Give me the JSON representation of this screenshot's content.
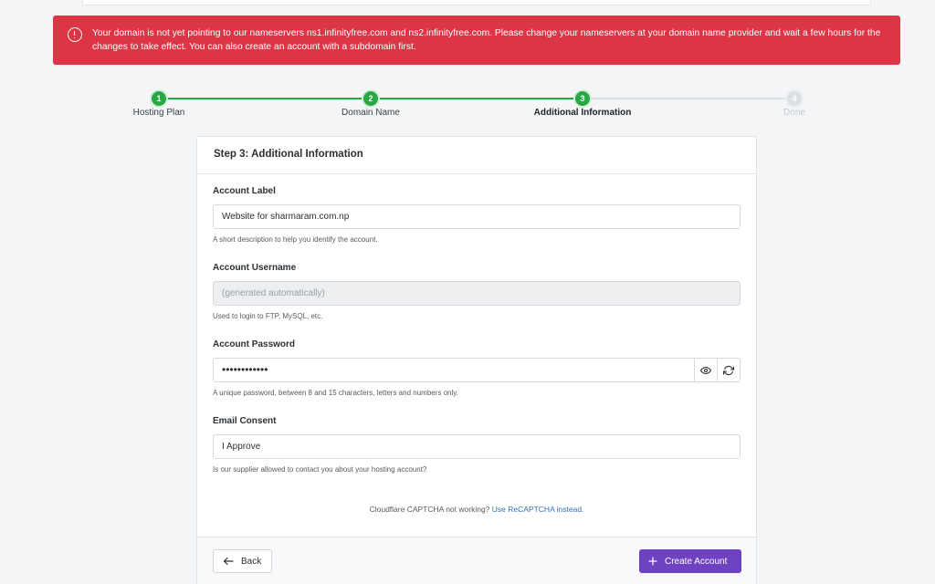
{
  "alert": {
    "text": "Your domain is not yet pointing to our nameservers ns1.infinityfree.com and ns2.infinityfree.com. Please change your nameservers at your domain name provider and wait a few hours for the changes to take effect. You can also create an account with a subdomain first.",
    "color": "#dc3545"
  },
  "stepper": {
    "steps": [
      {
        "number": "1",
        "label": "Hosting Plan",
        "state": "done"
      },
      {
        "number": "2",
        "label": "Domain Name",
        "state": "done"
      },
      {
        "number": "3",
        "label": "Additional Information",
        "state": "active"
      },
      {
        "number": "4",
        "label": "Done",
        "state": "todo"
      }
    ],
    "done_color": "#28a745"
  },
  "card": {
    "title": "Step 3: Additional Information",
    "fields": {
      "account_label": {
        "label": "Account Label",
        "value": "Website for sharmaram.com.np",
        "help": "A short description to help you identify the account."
      },
      "account_username": {
        "label": "Account Username",
        "placeholder": "(generated automatically)",
        "help": "Used to login to FTP, MySQL, etc."
      },
      "account_password": {
        "label": "Account Password",
        "value": "••••••••••••",
        "help": "A unique password, between 8 and 15 characters, letters and numbers only.",
        "show_icon": "eye-icon",
        "generate_icon": "refresh-icon"
      },
      "email_consent": {
        "label": "Email Consent",
        "value": "I Approve",
        "help": "Is our supplier allowed to contact you about your hosting account?"
      }
    },
    "captcha": {
      "text": "Cloudflare CAPTCHA not working?",
      "link": "Use ReCAPTCHA instead."
    },
    "footer": {
      "back_label": "Back",
      "create_label": "Create Account",
      "create_color": "#6f42c1"
    }
  }
}
